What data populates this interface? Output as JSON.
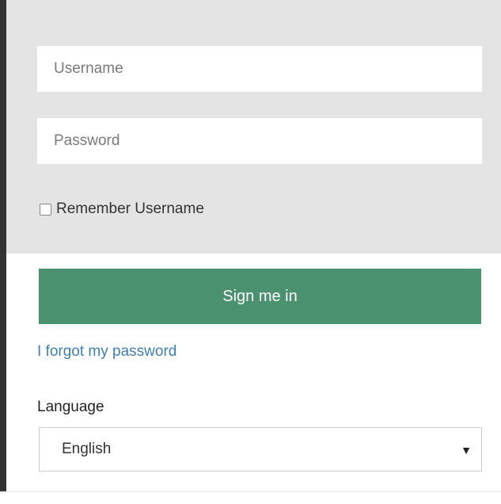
{
  "login_form": {
    "username": {
      "value": "",
      "placeholder": "Username"
    },
    "password": {
      "value": "",
      "placeholder": "Password"
    },
    "remember": {
      "label": "Remember Username",
      "checked": false
    },
    "sign_in_label": "Sign me in",
    "forgot_password_label": "I forgot my password"
  },
  "language": {
    "label": "Language",
    "selected": "English",
    "arrow_icon": "▼"
  },
  "colors": {
    "panel_background": "#e4e4e4",
    "primary_button": "#4a9170",
    "link": "#3f7fb6"
  }
}
